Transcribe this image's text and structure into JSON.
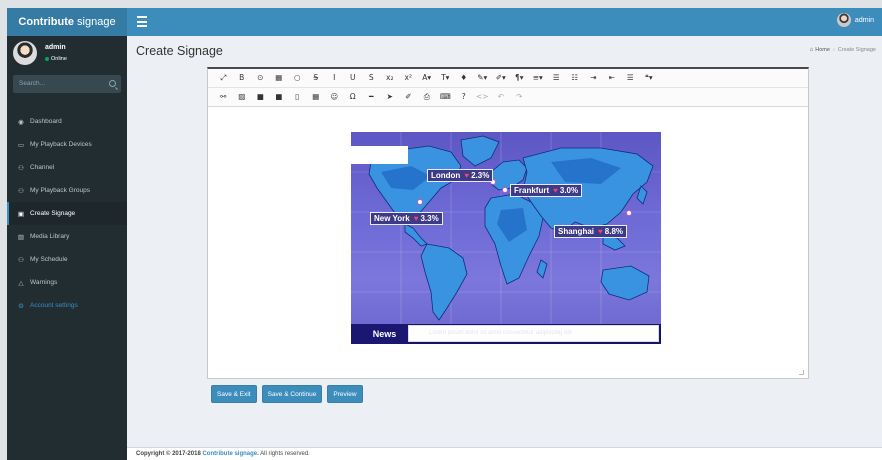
{
  "app": {
    "brand_bold": "Contribute",
    "brand_light": "signage"
  },
  "header": {
    "user_name": "admin"
  },
  "sidebar": {
    "user": {
      "name": "admin",
      "status": "Online"
    },
    "search": {
      "placeholder": "Search..."
    },
    "items": [
      {
        "icon": "dashboard-icon",
        "glyph": "◉",
        "label": "Dashboard",
        "active": false
      },
      {
        "icon": "monitor-icon",
        "glyph": "▭",
        "label": "My Playback Devices",
        "active": false
      },
      {
        "icon": "users-icon",
        "glyph": "⚇",
        "label": "Channel",
        "active": false
      },
      {
        "icon": "users-icon",
        "glyph": "⚇",
        "label": "My Playback Groups",
        "active": false
      },
      {
        "icon": "edit-icon",
        "glyph": "▣",
        "label": "Create Signage",
        "active": true
      },
      {
        "icon": "image-icon",
        "glyph": "▨",
        "label": "Media Library",
        "active": false
      },
      {
        "icon": "users-icon",
        "glyph": "⚇",
        "label": "My Schedule",
        "active": false
      },
      {
        "icon": "bell-icon",
        "glyph": "△",
        "label": "Warnings",
        "active": false
      },
      {
        "icon": "gears-icon",
        "glyph": "⚙",
        "label": "Account settings",
        "active": false,
        "link": true
      }
    ]
  },
  "page": {
    "title": "Create Signage",
    "breadcrumb": {
      "home": "Home",
      "current": "Create Signage"
    }
  },
  "editor": {
    "toolbar_row1": [
      {
        "icon": "expand-icon",
        "glyph": "⤢"
      },
      {
        "icon": "bold-icon",
        "glyph": "B"
      },
      {
        "icon": "circle-icon",
        "glyph": "⊙"
      },
      {
        "icon": "table-icon",
        "glyph": "▦"
      },
      {
        "icon": "circle-outline-icon",
        "glyph": "○"
      },
      {
        "icon": "strike-through-icon",
        "glyph": "S̶"
      },
      {
        "icon": "italic-icon",
        "glyph": "I"
      },
      {
        "icon": "underline-icon",
        "glyph": "U"
      },
      {
        "icon": "strikethrough-icon",
        "glyph": "S"
      },
      {
        "icon": "subscript-icon",
        "glyph": "x₂"
      },
      {
        "icon": "superscript-icon",
        "glyph": "x²"
      },
      {
        "icon": "font-color-icon",
        "glyph": "A▾"
      },
      {
        "icon": "font-size-icon",
        "glyph": "T▾"
      },
      {
        "icon": "drop-icon",
        "glyph": "♦"
      },
      {
        "icon": "brush-icon",
        "glyph": "✎▾"
      },
      {
        "icon": "pen-icon",
        "glyph": "✐▾"
      },
      {
        "icon": "paragraph-icon",
        "glyph": "¶▾"
      },
      {
        "icon": "align-icon",
        "glyph": "≡▾"
      },
      {
        "icon": "ordered-list-icon",
        "glyph": "☰"
      },
      {
        "icon": "unordered-list-icon",
        "glyph": "☷"
      },
      {
        "icon": "indent-icon",
        "glyph": "⇥"
      },
      {
        "icon": "outdent-icon",
        "glyph": "⇤"
      },
      {
        "icon": "align-justify-icon",
        "glyph": "☰"
      },
      {
        "icon": "quote-icon",
        "glyph": "❝▾"
      }
    ],
    "toolbar_row2": [
      {
        "icon": "link-icon",
        "glyph": "⚯"
      },
      {
        "icon": "image-icon",
        "glyph": "▨"
      },
      {
        "icon": "video-icon",
        "glyph": "■"
      },
      {
        "icon": "camera-icon",
        "glyph": "■"
      },
      {
        "icon": "file-icon",
        "glyph": "▯"
      },
      {
        "icon": "table-icon",
        "glyph": "▦"
      },
      {
        "icon": "emoticon-icon",
        "glyph": "☺"
      },
      {
        "icon": "special-char-icon",
        "glyph": "Ω"
      },
      {
        "icon": "hr-icon",
        "glyph": "━"
      },
      {
        "icon": "cursor-icon",
        "glyph": "➤"
      },
      {
        "icon": "eraser-icon",
        "glyph": "✐"
      },
      {
        "icon": "print-icon",
        "glyph": "⎙"
      },
      {
        "icon": "keyboard-icon",
        "glyph": "⌨"
      },
      {
        "icon": "help-icon",
        "glyph": "?"
      },
      {
        "icon": "code-view-icon",
        "glyph": "<>",
        "dim": true
      },
      {
        "icon": "undo-icon",
        "glyph": "↶",
        "dim": true
      },
      {
        "icon": "redo-icon",
        "glyph": "↷",
        "dim": true
      }
    ],
    "signage": {
      "cities": [
        {
          "name": "London",
          "change": "2.3%"
        },
        {
          "name": "Frankfurt",
          "change": "3.0%"
        },
        {
          "name": "New York",
          "change": "3.3%"
        },
        {
          "name": "Shanghai",
          "change": "8.8%"
        }
      ],
      "news_label": "News",
      "news_ticker": "Lorem ipsum dolor sit amet consectetur adipiscing elit"
    }
  },
  "actions": {
    "save_exit": "Save & Exit",
    "save_continue": "Save & Continue",
    "preview": "Preview"
  },
  "footer": {
    "copyright": "Copyright © 2017-2018",
    "brand": "Contribute signage.",
    "rights": "All rights reserved."
  }
}
